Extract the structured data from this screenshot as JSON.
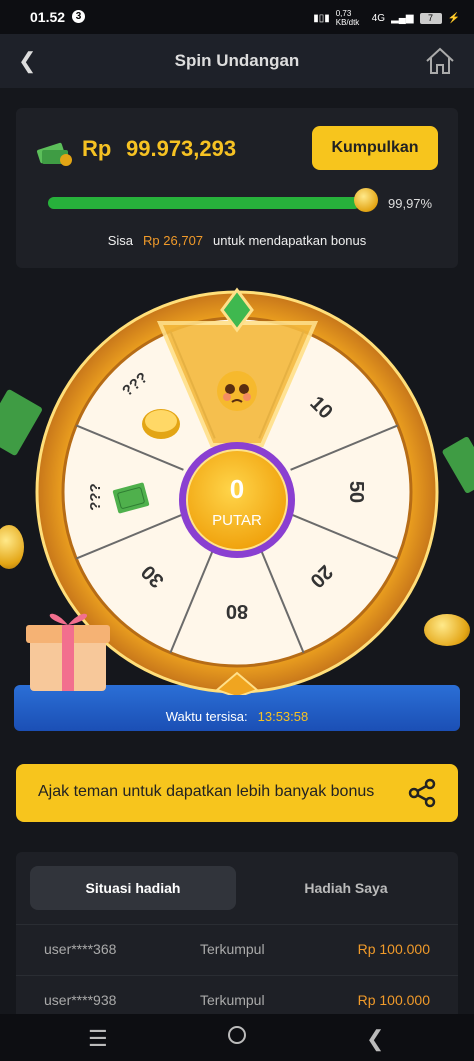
{
  "status": {
    "time": "01.52",
    "notif_count": "3",
    "net_speed": "0,73 KB/dtk",
    "network": "4G",
    "battery": "7"
  },
  "app": {
    "title": "Spin Undangan"
  },
  "balance": {
    "currency": "Rp",
    "amount": "99.973,293",
    "collect_label": "Kumpulkan",
    "progress_percent": 99.97,
    "progress_label": "99,97%",
    "remaining_prefix": "Sisa",
    "remaining_amount": "Rp 26,707",
    "remaining_suffix": "untuk mendapatkan bonus"
  },
  "wheel": {
    "segments": [
      "10",
      "50",
      "20",
      "80",
      "30",
      "???",
      "???"
    ],
    "spins_left": "0",
    "spin_label": "PUTAR",
    "timer_label": "Waktu tersisa:",
    "timer_value": "13:53:58"
  },
  "invite": {
    "label": "Ajak teman untuk dapatkan lebih banyak bonus"
  },
  "history": {
    "tabs": [
      {
        "label": "Situasi hadiah"
      },
      {
        "label": "Hadiah Saya"
      }
    ],
    "rows": [
      {
        "user": "user****368",
        "status": "Terkumpul",
        "prize": "Rp 100.000"
      },
      {
        "user": "user****938",
        "status": "Terkumpul",
        "prize": "Rp 100.000"
      }
    ]
  },
  "colors": {
    "accent": "#f7c51d",
    "progress": "#27b13b",
    "highlight": "#f09a2a"
  }
}
